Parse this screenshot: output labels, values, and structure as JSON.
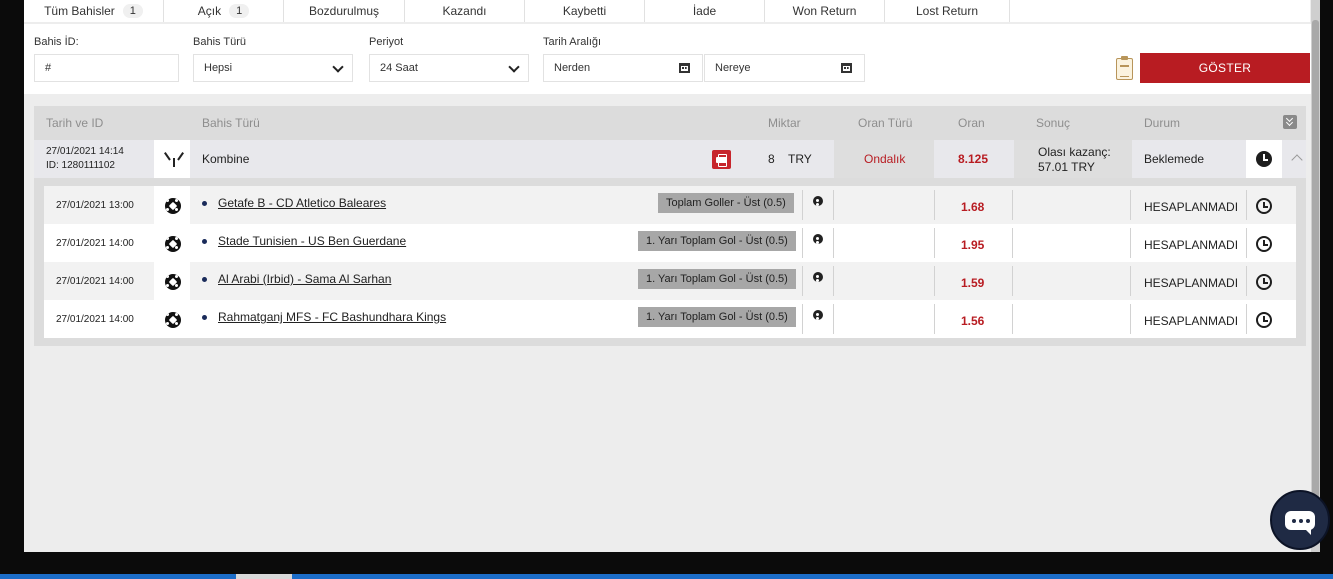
{
  "tabs": [
    {
      "label": "Tüm Bahisler",
      "count": "1"
    },
    {
      "label": "Açık",
      "count": "1"
    },
    {
      "label": "Bozdurulmuş",
      "count": ""
    },
    {
      "label": "Kazandı",
      "count": ""
    },
    {
      "label": "Kaybetti",
      "count": ""
    },
    {
      "label": "İade",
      "count": ""
    },
    {
      "label": "Won Return",
      "count": ""
    },
    {
      "label": "Lost Return",
      "count": ""
    }
  ],
  "filters": {
    "bet_id_label": "Bahis İD:",
    "bet_id_placeholder": "#",
    "bet_type_label": "Bahis Türü",
    "bet_type_value": "Hepsi",
    "period_label": "Periyot",
    "period_value": "24 Saat",
    "date_range_label": "Tarih Aralığı",
    "from_placeholder": "Nerden",
    "to_placeholder": "Nereye",
    "show_button": "GÖSTER"
  },
  "table_headers": {
    "date_id": "Tarih ve ID",
    "bet_type": "Bahis Türü",
    "amount": "Miktar",
    "odd_type": "Oran Türü",
    "odd": "Oran",
    "result": "Sonuç",
    "status": "Durum"
  },
  "bet": {
    "datetime": "27/01/2021 14:14",
    "id": "ID: 1280111102",
    "type": "Kombine",
    "amount": "8",
    "currency": "TRY",
    "odd_type": "Ondalık",
    "odd": "8.125",
    "potential_label": "Olası kazanç:",
    "potential_value": "57.01 TRY",
    "status": "Beklemede"
  },
  "selections": [
    {
      "date": "27/01/2021 13:00",
      "match": "Getafe B - CD Atletico Baleares",
      "market": "Toplam Goller - Üst (0.5)",
      "odd": "1.68",
      "status": "HESAPLANMADI"
    },
    {
      "date": "27/01/2021 14:00",
      "match": "Stade Tunisien - US Ben Guerdane",
      "market": "1. Yarı Toplam Gol - Üst (0.5)",
      "odd": "1.95",
      "status": "HESAPLANMADI"
    },
    {
      "date": "27/01/2021 14:00",
      "match": "Al Arabi (Irbid) - Sama Al Sarhan",
      "market": "1. Yarı Toplam Gol - Üst (0.5)",
      "odd": "1.59",
      "status": "HESAPLANMADI"
    },
    {
      "date": "27/01/2021 14:00",
      "match": "Rahmatganj MFS - FC Bashundhara Kings",
      "market": "1. Yarı Toplam Gol - Üst (0.5)",
      "odd": "1.56",
      "status": "HESAPLANMADI"
    }
  ],
  "colors": {
    "accent": "#b81c22",
    "page_bg": "#ededed",
    "chat_bg": "#1f2a44"
  }
}
